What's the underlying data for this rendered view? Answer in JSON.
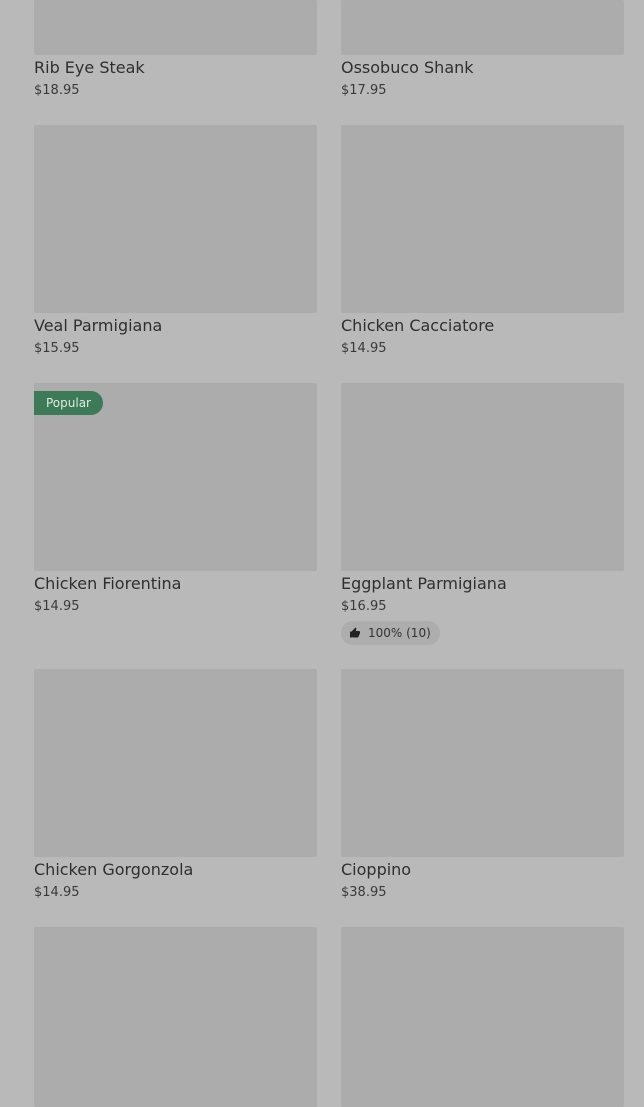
{
  "menu": {
    "items": [
      {
        "name": "Rib Eye Steak",
        "price": "$18.95"
      },
      {
        "name": "Ossobuco Shank",
        "price": "$17.95"
      },
      {
        "name": "Veal Parmigiana",
        "price": "$15.95"
      },
      {
        "name": "Chicken Cacciatore",
        "price": "$14.95"
      },
      {
        "name": "Chicken Fiorentina",
        "price": "$14.95",
        "badge": "Popular"
      },
      {
        "name": "Eggplant Parmigiana",
        "price": "$16.95",
        "rating": "100% (10)"
      },
      {
        "name": "Chicken Gorgonzola",
        "price": "$14.95"
      },
      {
        "name": "Cioppino",
        "price": "$38.95"
      }
    ]
  },
  "colors": {
    "page_background": "#b9b9b9",
    "image_placeholder": "#acacac",
    "badge_background": "#3d7a58",
    "rating_pill": "#adadad"
  },
  "icons": {
    "rating": "thumbs-up-icon"
  }
}
